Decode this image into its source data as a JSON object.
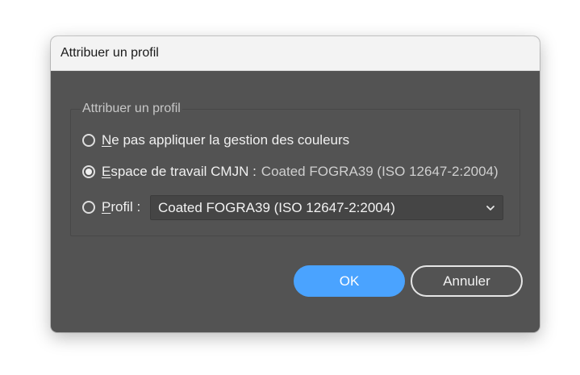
{
  "dialog": {
    "title": "Attribuer un profil",
    "group_legend": "Attribuer un profil",
    "options": [
      {
        "label_underlined": "N",
        "label_rest": "e pas appliquer la gestion des couleurs",
        "checked": false
      },
      {
        "label_underlined": "E",
        "label_rest": "space de travail CMJN :",
        "value": "Coated FOGRA39 (ISO 12647-2:2004)",
        "checked": true
      },
      {
        "label_underlined": "P",
        "label_rest": "rofil :",
        "checked": false
      }
    ],
    "profile_select": {
      "selected": "Coated FOGRA39 (ISO 12647-2:2004)",
      "icon": "chevron-down-icon"
    },
    "buttons": {
      "ok": "OK",
      "cancel": "Annuler"
    }
  },
  "colors": {
    "dialog_bg": "#535353",
    "accent": "#4aa3ff",
    "titlebar_bg": "#f3f3f3"
  }
}
